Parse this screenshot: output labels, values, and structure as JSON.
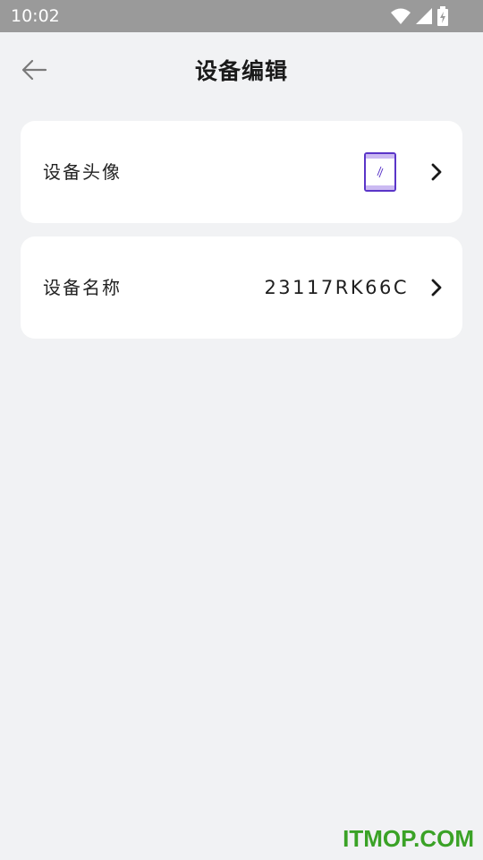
{
  "status_bar": {
    "time": "10:02",
    "icons": [
      "wifi-icon",
      "cell-signal-icon",
      "battery-charging-icon"
    ]
  },
  "header": {
    "title": "设备编辑",
    "back_icon": "arrow-left-icon"
  },
  "rows": [
    {
      "label": "设备头像",
      "value_icon": "device-phone-thumbnail",
      "chevron_icon": "chevron-right-icon"
    },
    {
      "label": "设备名称",
      "value": "23117RK66C",
      "chevron_icon": "chevron-right-icon"
    }
  ],
  "watermark": "ITMOP.COM",
  "colors": {
    "background": "#f1f2f4",
    "status_bar": "#9a9a9a",
    "card": "#ffffff",
    "device_accent": "#5a35c8",
    "watermark": "#3aa226"
  }
}
